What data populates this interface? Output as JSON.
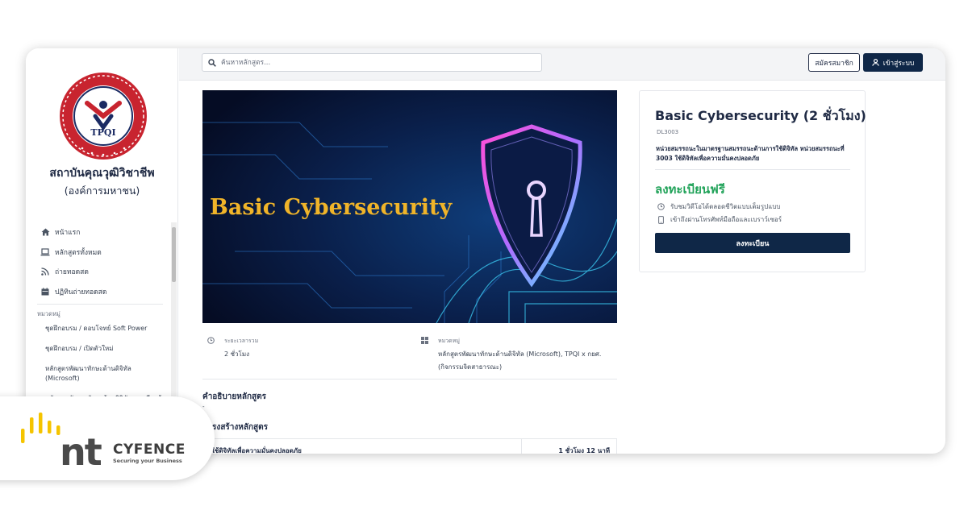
{
  "sidebar": {
    "logo_text": "TPQI",
    "logo_ring_text": "THAILAND PROFESSIONAL QUALIFICATION INSTITUTE",
    "institute_name": "สถาบันคุณวุฒิวิชาชีพ",
    "institute_type": "(องค์การมหาชน)",
    "nav": [
      {
        "label": "หน้าแรก",
        "icon": "home-icon"
      },
      {
        "label": "หลักสูตรทั้งหมด",
        "icon": "laptop-icon"
      },
      {
        "label": "ถ่ายทอดสด",
        "icon": "rss-icon"
      },
      {
        "label": "ปฏิทินถ่ายทอดสด",
        "icon": "calendar-icon"
      }
    ],
    "category_title": "หมวดหมู่",
    "categories": [
      "ชุดฝึกอบรม / ดอบโจทย์ Soft Power",
      "ชุดฝึกอบรม / เปิดตัวใหม่",
      "หลักสูตรพัฒนาทักษะด้านดิจิทัล (Microsoft)",
      "หลักสูตรพัฒนาทักษะด้านดิจิทัล การเรียนรู้"
    ]
  },
  "header": {
    "search_placeholder": "ค้นหาหลักสูตร...",
    "register_label": "สมัครสมาชิก",
    "login_label": "เข้าสู่ระบบ"
  },
  "course": {
    "banner_text": "Basic  Cybersecurity",
    "duration_label": "ระยะเวลารวม",
    "duration_value": "2 ชั่วโมง",
    "category_label": "หมวดหมู่",
    "category_value_1": "หลักสูตรพัฒนาทักษะด้านดิจิทัล (Microsoft), TPQI x กยศ.",
    "category_value_2": "(กิจกรรมจิตสาธารณะ)",
    "description_title": "คำอธิบายหลักสูตร",
    "description_body": "-",
    "structure_title": "โครงสร้างหลักสูตร",
    "structure_item": "ใช้ดิจิทัลเพื่อความมั่นคงปลอดภัย",
    "structure_duration": "1 ชั่วโมง 12 นาที"
  },
  "card": {
    "title": "Basic Cybersecurity (2 ชั่วโมง)",
    "code": "DL3003",
    "description": "หน่วยสมรรถนะในมาตรฐานสมรรถนะด้านการใช้ดิจิทัล หน่วยสมรรถนะที่ 3003 ใช้ดิจิทัลเพื่อความมั่นคงปลอดภัย",
    "price": "ลงทะเบียนฟรี",
    "feature_1": "รับชมวิดีโอได้ตลอดชีวิตแบบเต็มรูปแบบ",
    "feature_2": "เข้าถึงผ่านโทรศัพท์มือถือและเบราว์เซอร์",
    "button": "ลงทะเบียน"
  },
  "brand": {
    "mark": "nt",
    "name": "CYFENCE",
    "tagline": "Securing your Business"
  },
  "colors": {
    "navy": "#0f2747",
    "green": "#22a35a",
    "logo_red": "#c8242f",
    "logo_navy": "#1b2b63",
    "banner_gold": "#f0b429",
    "brand_yellow": "#f5c400"
  }
}
